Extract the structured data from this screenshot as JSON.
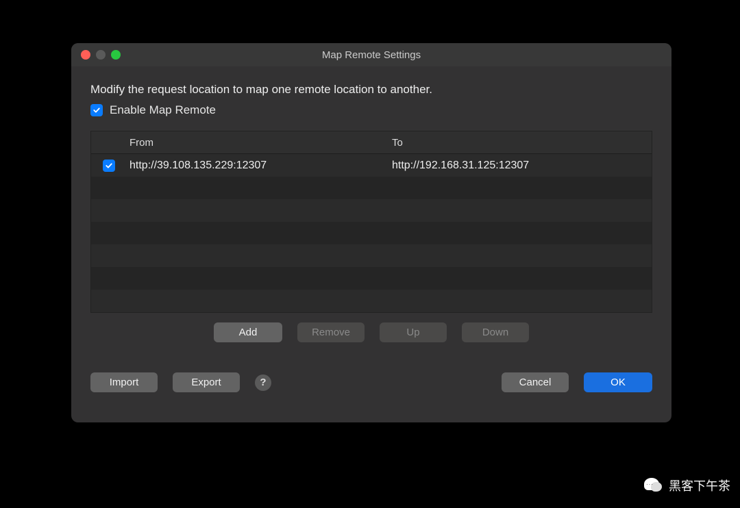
{
  "window": {
    "title": "Map Remote Settings"
  },
  "main": {
    "description": "Modify the request location to map one remote location to another.",
    "enable_label": "Enable Map Remote",
    "enable_checked": true,
    "table": {
      "headers": {
        "from": "From",
        "to": "To"
      },
      "rows": [
        {
          "checked": true,
          "from": "http://39.108.135.229:12307",
          "to": "http://192.168.31.125:12307"
        }
      ]
    },
    "table_buttons": {
      "add": "Add",
      "remove": "Remove",
      "up": "Up",
      "down": "Down"
    },
    "action_buttons": {
      "import": "Import",
      "export": "Export",
      "cancel": "Cancel",
      "ok": "OK"
    },
    "help_symbol": "?"
  },
  "watermark": {
    "text": "黑客下午茶"
  }
}
